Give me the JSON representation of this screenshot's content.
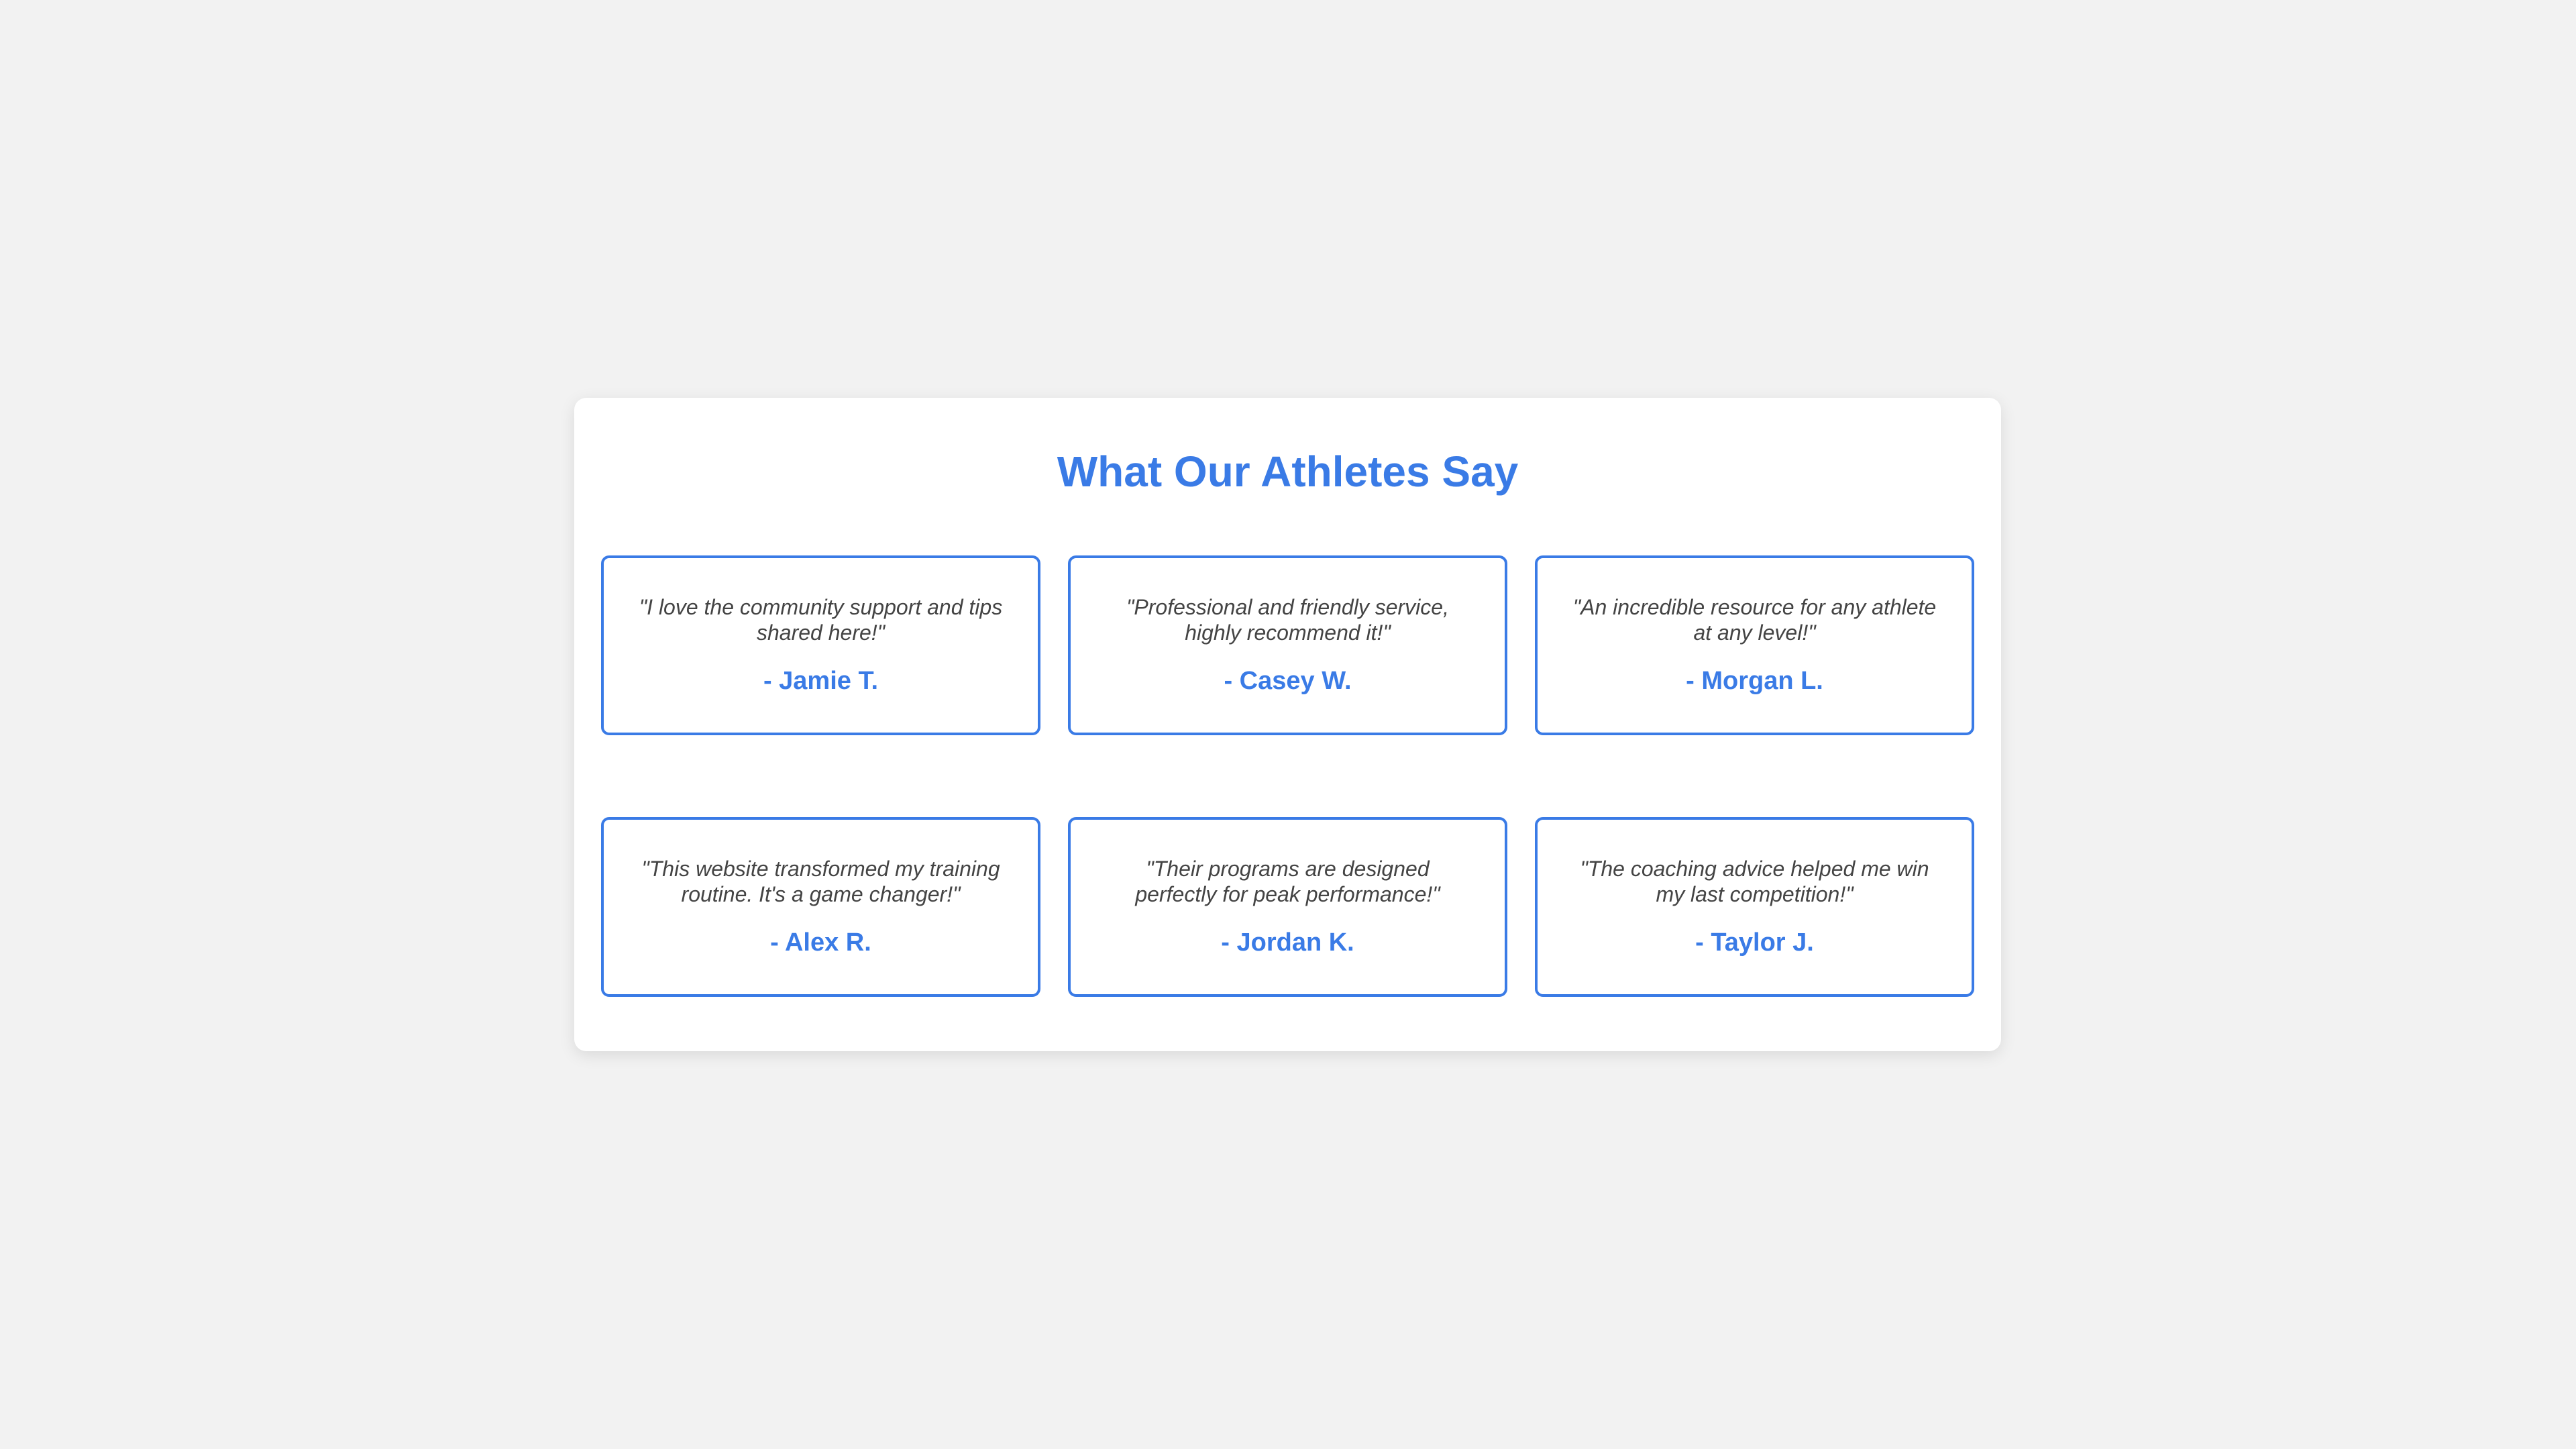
{
  "colors": {
    "accent": "#3a7be6",
    "background": "#f2f2f2",
    "panel": "#ffffff",
    "quote_text": "#444444"
  },
  "section": {
    "title": "What Our Athletes Say"
  },
  "testimonials": [
    {
      "quote": "\"I love the community support and tips shared here!\"",
      "author": "- Jamie T."
    },
    {
      "quote": "\"Professional and friendly service, highly recommend it!\"",
      "author": "- Casey W."
    },
    {
      "quote": "\"An incredible resource for any athlete at any level!\"",
      "author": "- Morgan L."
    },
    {
      "quote": "\"This website transformed my training routine. It's a game changer!\"",
      "author": "- Alex R."
    },
    {
      "quote": "\"Their programs are designed perfectly for peak performance!\"",
      "author": "- Jordan K."
    },
    {
      "quote": "\"The coaching advice helped me win my last competition!\"",
      "author": "- Taylor J."
    }
  ]
}
